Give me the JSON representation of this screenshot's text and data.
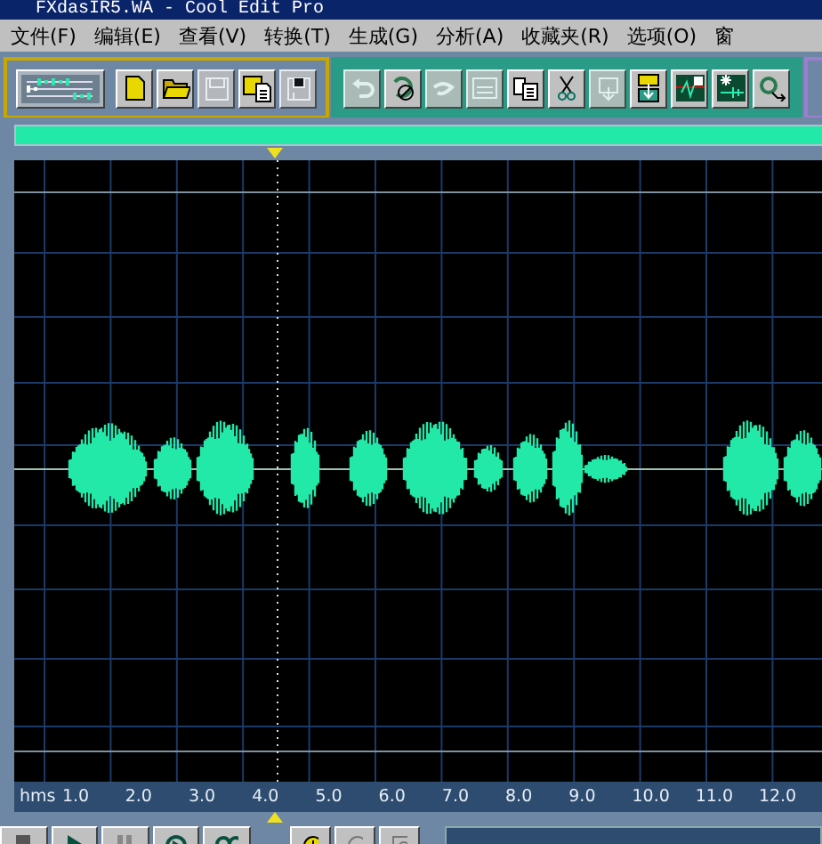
{
  "window": {
    "title": "FXdasIR5.WA  - Cool Edit Pro"
  },
  "menu": [
    "文件(F)",
    "编辑(E)",
    "查看(V)",
    "转换(T)",
    "生成(G)",
    "分析(A)",
    "收藏夹(R)",
    "选项(O)",
    "窗"
  ],
  "toolbar_groups": [
    {
      "kind": "file",
      "buttons": [
        {
          "disabled": false
        },
        {
          "disabled": false
        },
        {
          "disabled": false
        },
        {
          "disabled": true
        },
        {
          "disabled": false
        },
        {
          "disabled": true
        }
      ]
    },
    {
      "kind": "edit",
      "buttons": [
        {
          "disabled": true
        },
        {
          "disabled": false
        },
        {
          "disabled": true
        },
        {
          "disabled": true
        },
        {
          "disabled": false
        },
        {
          "disabled": false
        },
        {
          "disabled": true
        },
        {
          "disabled": false
        },
        {
          "disabled": false
        },
        {
          "disabled": false
        },
        {
          "disabled": false
        }
      ]
    }
  ],
  "ruler": {
    "unit": "hms",
    "ticks": [
      "1.0",
      "2.0",
      "3.0",
      "4.0",
      "5.0",
      "6.0",
      "7.0",
      "8.0",
      "9.0",
      "10.0",
      "11.0",
      "12.0"
    ]
  },
  "zoom_in_enabled": true
}
